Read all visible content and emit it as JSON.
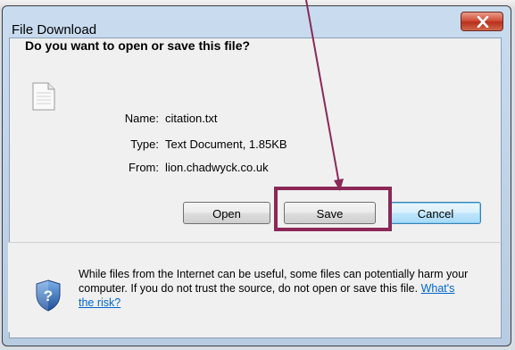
{
  "dialog": {
    "title": "File Download",
    "question": "Do you want to open or save this file?",
    "file": {
      "name_label": "Name:",
      "name_value": "citation.txt",
      "type_label": "Type:",
      "type_value": "Text Document, 1.85KB",
      "from_label": "From:",
      "from_value": "lion.chadwyck.co.uk"
    },
    "buttons": {
      "open": "Open",
      "save": "Save",
      "cancel": "Cancel"
    },
    "warning": {
      "text": "While files from the Internet can be useful, some files can potentially harm your computer. If you do not trust the source, do not open or save this file.",
      "link": "What's the risk?"
    }
  },
  "colors": {
    "annotation": "#8b2858",
    "link": "#0066cc",
    "close_button": "#c9442c"
  },
  "icons": {
    "close": "close-x-icon",
    "file": "text-file-icon",
    "shield": "security-shield-icon"
  }
}
